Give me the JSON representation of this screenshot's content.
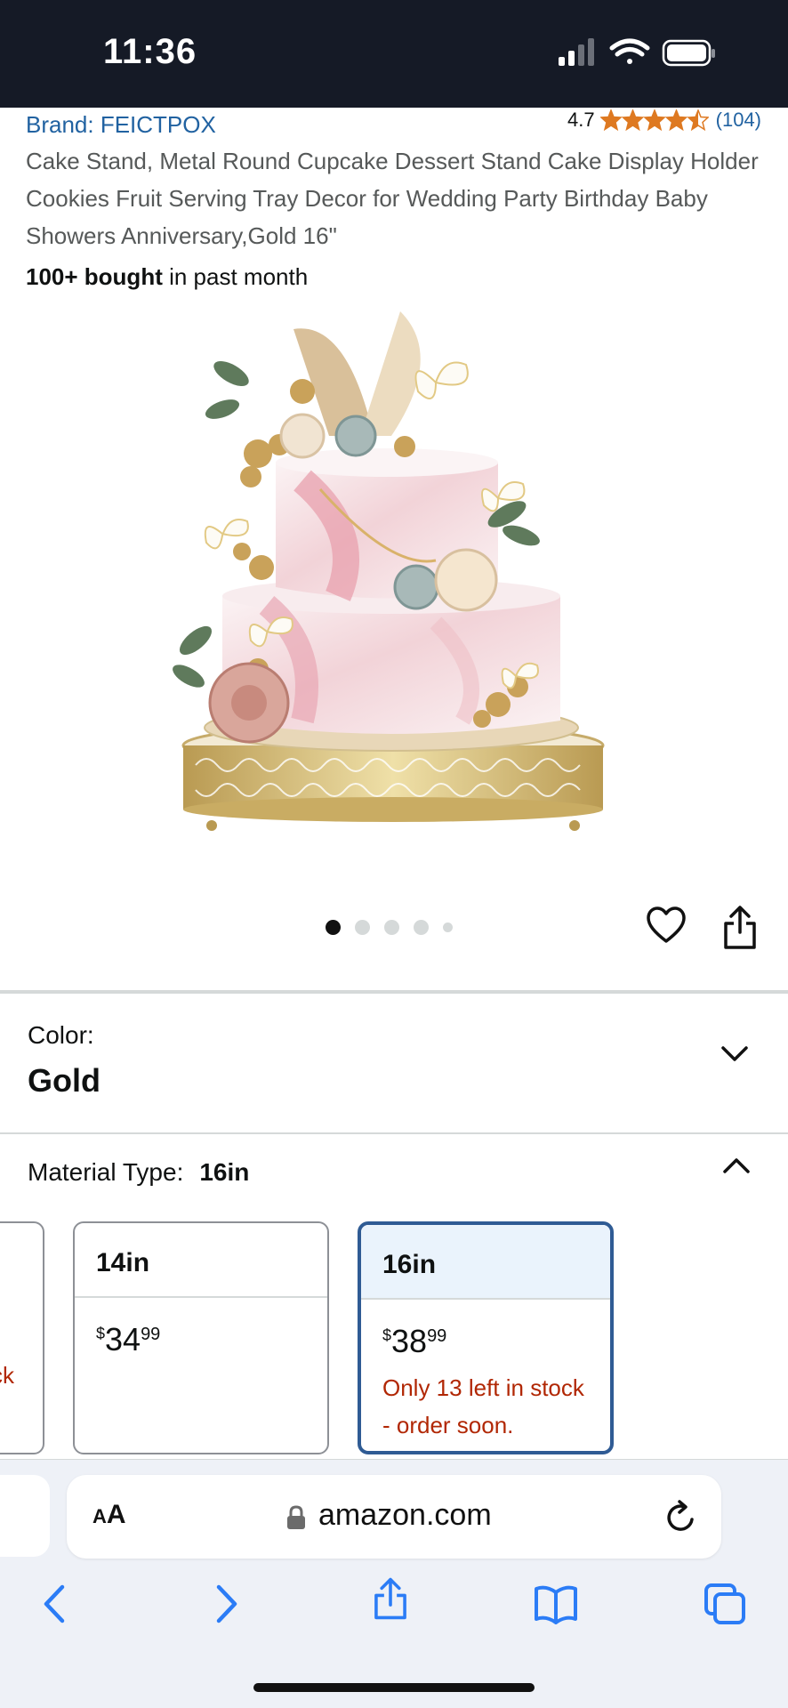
{
  "status_bar": {
    "time": "11:36",
    "icons": [
      "signal-icon",
      "wifi-icon",
      "battery-icon"
    ]
  },
  "product": {
    "brand": "Brand: FEICTPOX",
    "rating_value": "4.7",
    "rating_stars": 4.5,
    "rating_count": "(104)",
    "title": "Cake Stand, Metal Round Cupcake Dessert Stand Cake Display Holder Cookies Fruit Serving Tray Decor for Wedding Party Birthday Baby Showers Anniversary,Gold 16\"",
    "bought_bold": "100+ bought",
    "bought_rest": " in past month",
    "image_alt": "Gold cake stand with two-tier pink marble cake",
    "image_count": 5,
    "image_index": 1
  },
  "color": {
    "label": "Color:",
    "value": "Gold"
  },
  "material": {
    "label": "Material Type:",
    "value": "16in",
    "options": [
      {
        "name": "",
        "stock": "ck"
      },
      {
        "name": "14in",
        "price_symbol": "$",
        "price_whole": "34",
        "price_cents": "99",
        "stock": ""
      },
      {
        "name": "16in",
        "price_symbol": "$",
        "price_whole": "38",
        "price_cents": "99",
        "stock": "Only 13 left in stock - order soon.",
        "selected": true
      }
    ]
  },
  "browser": {
    "aa_label_small": "A",
    "aa_label_large": "A",
    "url": "amazon.com"
  },
  "colors": {
    "link": "#2162a1",
    "star": "#de7921",
    "stock_warning": "#b12704",
    "selected_border": "#2f5b94",
    "status_bar_bg": "#151a26",
    "ios_blue": "#2b7cf6"
  }
}
